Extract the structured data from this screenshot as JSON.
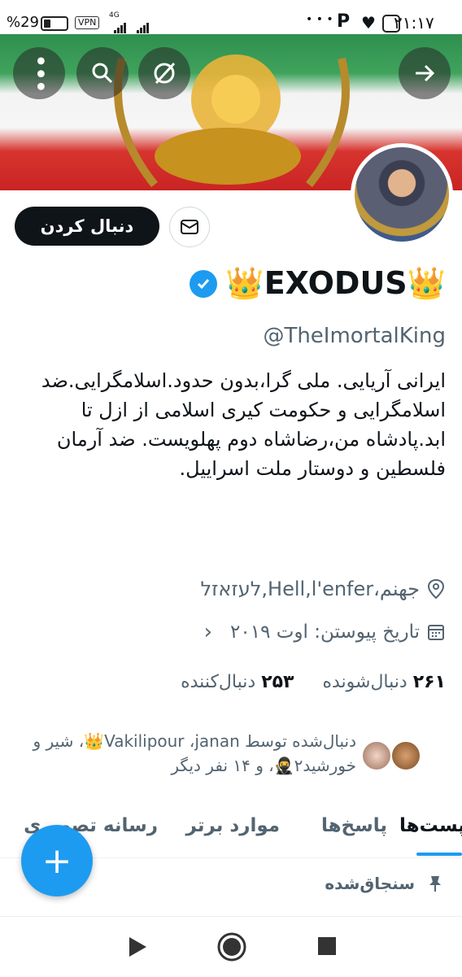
{
  "status_bar": {
    "battery": "%29",
    "battery_level": 0.29,
    "vpn": "VPN",
    "network": "4G",
    "dots": "• • •",
    "time": "۲۱:۱۷"
  },
  "header": {
    "back_icon": "arrow-right-icon",
    "search_icon": "search-icon",
    "more_icon": "more-vertical-icon"
  },
  "profile": {
    "follow_label": "دنبال کردن",
    "name": "👑EXODUS👑",
    "handle": "@TheImortalKing",
    "bio": "ایرانی آریایی. ملی گرا،بدون حدود.اسلامگرایی.ضد اسلامگرایی و حکومت کیری اسلامی از ازل تا ابد.پادشاه من،رضاشاه دوم پهلویست. ضد آرمان فلسطین و دوستار ملت اسراییل.",
    "location": "جهنم،Hell,l'enfer,לעזאזל",
    "joined": "تاریخ پیوستن: اوت ۲۰۱۹",
    "following_count": "۲۶۱",
    "following_label": "دنبال‌شونده",
    "followers_count": "۲۵۳",
    "followers_label": "دنبال‌کننده",
    "followed_by": "دنبال‌شده توسط Vakilipour ،janan👑، شیر و خورشید۲🥷، و ۱۴ نفر دیگر"
  },
  "tabs": [
    {
      "label": "پست‌ها"
    },
    {
      "label": "پاسخ‌ها"
    },
    {
      "label": "موارد برتر"
    },
    {
      "label": "رسانه تصویری"
    }
  ],
  "pinned_label": "سنجاق‌شده",
  "fab_label": "+",
  "colors": {
    "accent": "#1d9bf0",
    "text": "#0f1419",
    "muted": "#536471"
  }
}
